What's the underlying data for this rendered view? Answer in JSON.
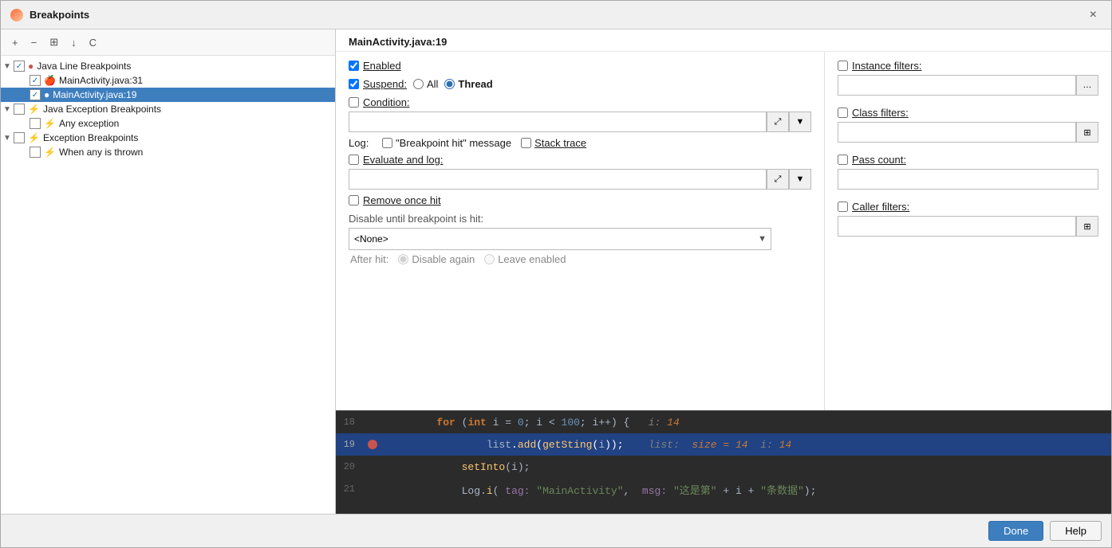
{
  "window": {
    "title": "Breakpoints",
    "close_label": "×"
  },
  "toolbar": {
    "add": "+",
    "remove": "−",
    "group": "⊞",
    "export": "↓",
    "filter": "C"
  },
  "tree": {
    "items": [
      {
        "level": 1,
        "label": "Java Line Breakpoints",
        "expanded": true,
        "checked": true,
        "icon": "🔴",
        "selected": false
      },
      {
        "level": 2,
        "label": "MainActivity.java:31",
        "expanded": false,
        "checked": true,
        "icon": "🍎",
        "selected": false
      },
      {
        "level": 2,
        "label": "MainActivity.java:19",
        "expanded": false,
        "checked": true,
        "icon": "🔴",
        "selected": true
      },
      {
        "level": 1,
        "label": "Java Exception Breakpoints",
        "expanded": true,
        "checked": false,
        "icon": "⚡",
        "selected": false
      },
      {
        "level": 2,
        "label": "Any exception",
        "expanded": false,
        "checked": false,
        "icon": "⚡",
        "selected": false
      },
      {
        "level": 1,
        "label": "Exception Breakpoints",
        "expanded": true,
        "checked": false,
        "icon": "⚡",
        "selected": false
      },
      {
        "level": 2,
        "label": "When any is thrown",
        "expanded": false,
        "checked": false,
        "icon": "⚡",
        "selected": false
      }
    ]
  },
  "detail": {
    "title": "MainActivity.java:19",
    "enabled_label": "Enabled",
    "suspend_label": "Suspend:",
    "all_label": "All",
    "thread_label": "Thread",
    "condition_label": "Condition:",
    "log_label": "Log:",
    "breakpoint_hit_label": "\"Breakpoint hit\" message",
    "stack_trace_label": "Stack trace",
    "evaluate_label": "Evaluate and log:",
    "remove_once_label": "Remove once hit",
    "disable_label": "Disable until breakpoint is hit:",
    "disable_select_value": "<None>",
    "disable_options": [
      "<None>"
    ],
    "after_hit_label": "After hit:",
    "disable_again_label": "Disable again",
    "leave_enabled_label": "Leave enabled"
  },
  "filters": {
    "instance_label": "Instance filters:",
    "class_label": "Class filters:",
    "pass_count_label": "Pass count:",
    "caller_label": "Caller filters:"
  },
  "code": {
    "lines": [
      {
        "num": "18",
        "content": "for_loop",
        "highlighted": false
      },
      {
        "num": "19",
        "content": "list_add",
        "highlighted": true,
        "has_bp": true
      },
      {
        "num": "20",
        "content": "set_into",
        "highlighted": false
      },
      {
        "num": "21",
        "content": "log_i",
        "highlighted": false
      }
    ],
    "line18_text": "for (int i = 0; i < 100; i++)",
    "line18_hint": "i: 14",
    "line19_text": "list.add(getSting(i));",
    "line19_hint": "list:  size = 14  i: 14",
    "line20_text": "setInto(i);",
    "line21_text": "Log.i(",
    "line21_tag": "tag:",
    "line21_tag_val": "\"MainActivity\"",
    "line21_msg": "msg:",
    "line21_msg_val": "\"这是第\" + i + \"条数据\"",
    "line21_end": ");"
  },
  "footer": {
    "done_label": "Done",
    "help_label": "Help"
  }
}
